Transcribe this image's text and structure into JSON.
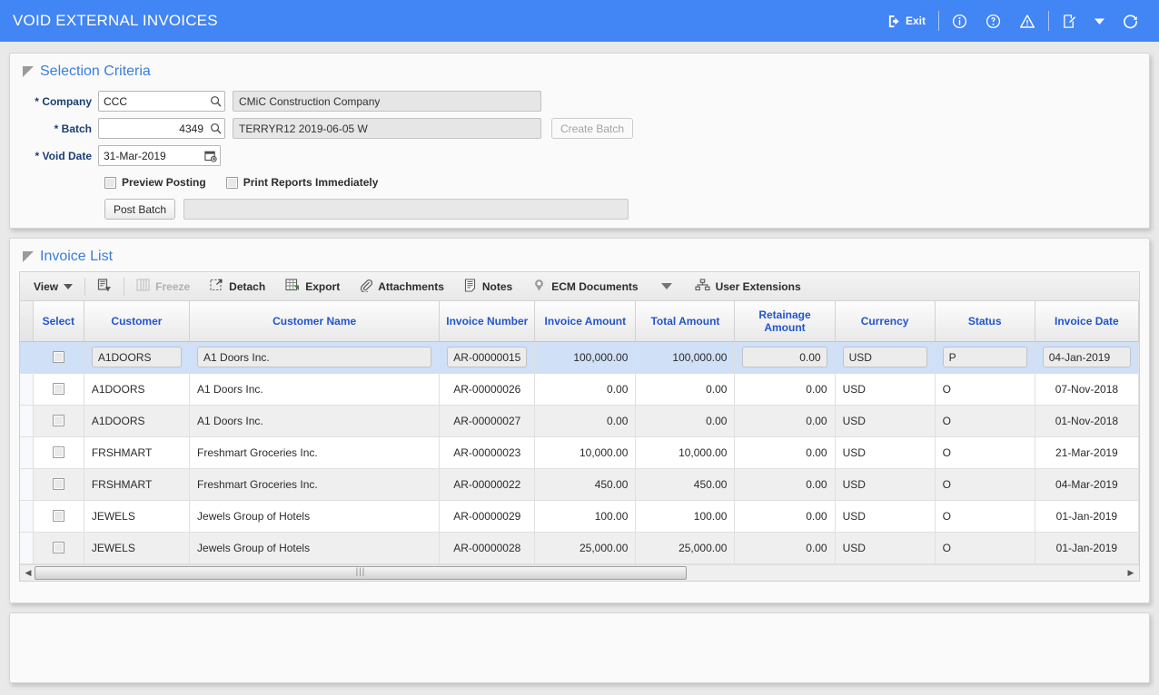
{
  "header": {
    "title": "VOID EXTERNAL INVOICES",
    "exit_label": "Exit",
    "icons": [
      "exit-icon",
      "info-icon",
      "help-icon",
      "warning-icon",
      "notes-edit-icon",
      "refresh-icon"
    ]
  },
  "selection_criteria": {
    "title": "Selection Criteria",
    "company": {
      "label": "Company",
      "required": "*",
      "value": "CCC",
      "description": "CMiC Construction Company"
    },
    "batch": {
      "label": "Batch",
      "required": "*",
      "value": "4349",
      "description": "TERRYR12 2019-06-05 W",
      "create_button": "Create Batch"
    },
    "void_date": {
      "label": "Void Date",
      "required": "*",
      "value": "31-Mar-2019"
    },
    "preview_posting": {
      "label": "Preview Posting",
      "checked": false
    },
    "print_reports": {
      "label": "Print Reports Immediately",
      "checked": false
    },
    "post_batch_button": "Post Batch",
    "status_message": ""
  },
  "invoice_list": {
    "title": "Invoice List",
    "toolbar": {
      "view": "View",
      "query_by_example": "query-by-example-icon",
      "freeze": "Freeze",
      "detach": "Detach",
      "export": "Export",
      "attachments": "Attachments",
      "notes": "Notes",
      "ecm_documents": "ECM Documents",
      "user_extensions": "User Extensions"
    },
    "columns": [
      "Select",
      "Customer",
      "Customer Name",
      "Invoice Number",
      "Invoice Amount",
      "Total Amount",
      "Retainage Amount",
      "Currency",
      "Status",
      "Invoice Date"
    ],
    "rows": [
      {
        "selected": true,
        "checked": false,
        "customer": "A1DOORS",
        "customer_name": "A1 Doors Inc.",
        "invoice_number": "AR-00000015",
        "invoice_amount": "100,000.00",
        "total_amount": "100,000.00",
        "retainage_amount": "0.00",
        "currency": "USD",
        "status": "P",
        "invoice_date": "04-Jan-2019"
      },
      {
        "selected": false,
        "checked": false,
        "customer": "A1DOORS",
        "customer_name": "A1 Doors Inc.",
        "invoice_number": "AR-00000026",
        "invoice_amount": "0.00",
        "total_amount": "0.00",
        "retainage_amount": "0.00",
        "currency": "USD",
        "status": "O",
        "invoice_date": "07-Nov-2018"
      },
      {
        "selected": false,
        "checked": false,
        "customer": "A1DOORS",
        "customer_name": "A1 Doors Inc.",
        "invoice_number": "AR-00000027",
        "invoice_amount": "0.00",
        "total_amount": "0.00",
        "retainage_amount": "0.00",
        "currency": "USD",
        "status": "O",
        "invoice_date": "01-Nov-2018"
      },
      {
        "selected": false,
        "checked": false,
        "customer": "FRSHMART",
        "customer_name": "Freshmart Groceries Inc.",
        "invoice_number": "AR-00000023",
        "invoice_amount": "10,000.00",
        "total_amount": "10,000.00",
        "retainage_amount": "0.00",
        "currency": "USD",
        "status": "O",
        "invoice_date": "21-Mar-2019"
      },
      {
        "selected": false,
        "checked": false,
        "customer": "FRSHMART",
        "customer_name": "Freshmart Groceries Inc.",
        "invoice_number": "AR-00000022",
        "invoice_amount": "450.00",
        "total_amount": "450.00",
        "retainage_amount": "0.00",
        "currency": "USD",
        "status": "O",
        "invoice_date": "04-Mar-2019"
      },
      {
        "selected": false,
        "checked": false,
        "customer": "JEWELS",
        "customer_name": "Jewels Group of Hotels",
        "invoice_number": "AR-00000029",
        "invoice_amount": "100.00",
        "total_amount": "100.00",
        "retainage_amount": "0.00",
        "currency": "USD",
        "status": "O",
        "invoice_date": "01-Jan-2019"
      },
      {
        "selected": false,
        "checked": false,
        "customer": "JEWELS",
        "customer_name": "Jewels Group of Hotels",
        "invoice_number": "AR-00000028",
        "invoice_amount": "25,000.00",
        "total_amount": "25,000.00",
        "retainage_amount": "0.00",
        "currency": "USD",
        "status": "O",
        "invoice_date": "01-Jan-2019"
      }
    ]
  },
  "colors": {
    "brand_blue": "#4285f4",
    "header_text_blue": "#2255cc",
    "panel_title_blue": "#3b7ddd",
    "selected_row": "#cfe0f7",
    "alt_row": "#efefef"
  }
}
